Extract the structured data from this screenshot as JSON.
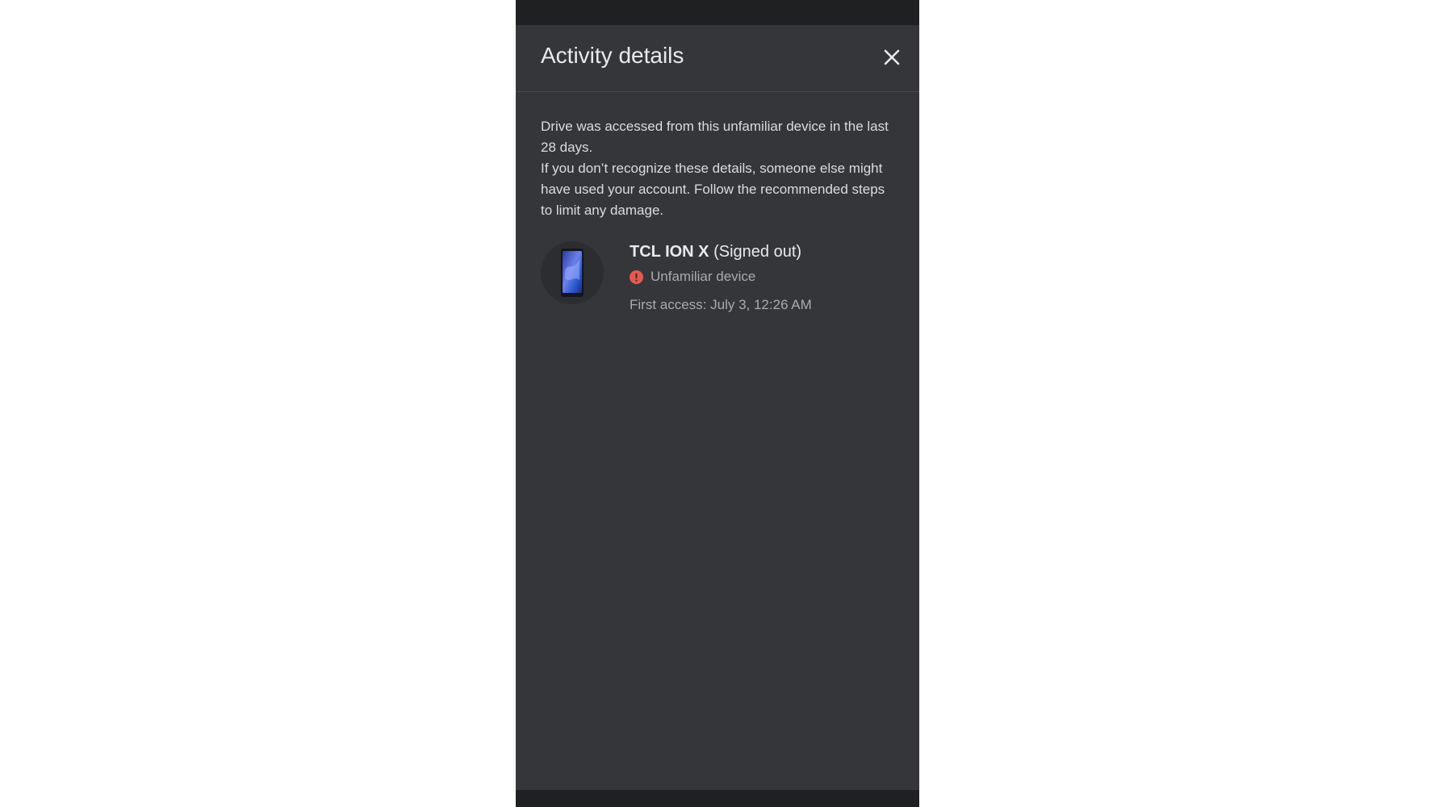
{
  "sheet": {
    "title": "Activity details",
    "close_icon": "close-icon"
  },
  "intro": {
    "line1": "Drive was accessed from this unfamiliar device in the last 28 days.",
    "line2": "If you don’t recognize these details, someone else might have used your account. Follow the recommended steps to limit any damage."
  },
  "device": {
    "model": "TCL ION X",
    "state": "(Signed out)",
    "status_label": "Unfamiliar device",
    "status_icon": "alert-icon",
    "status_color": "#e8594d",
    "first_access": "First access: July 3, 12:26 AM"
  },
  "colors": {
    "sheet_background": "#35363a",
    "status_bar": "#1f2022",
    "title_text": "#e8eaed",
    "secondary_text": "#a9abaf"
  }
}
